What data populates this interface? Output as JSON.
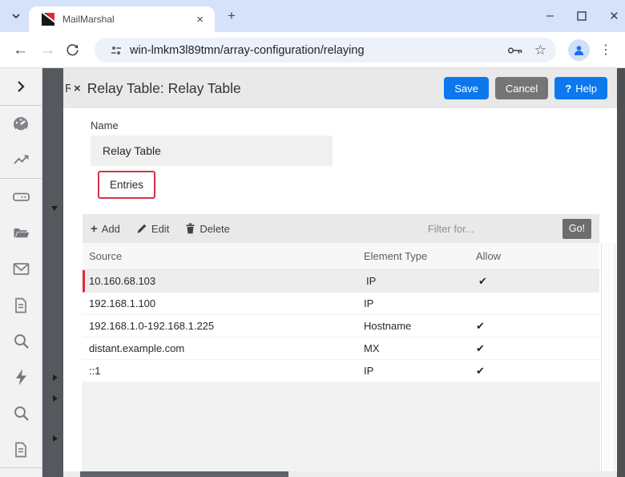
{
  "browser": {
    "tab_title": "MailMarshal",
    "url": "win-lmkm3l89tmn/array-configuration/relaying"
  },
  "glyphs": {
    "close": "×",
    "plus": "+",
    "minimize": "–",
    "back": "←",
    "forward": "→",
    "kebab": "⋮",
    "star": "☆"
  },
  "panel": {
    "clipped_text": "R",
    "close": "×",
    "title": "Relay Table: Relay Table",
    "save_label": "Save",
    "cancel_label": "Cancel",
    "help_q": "?",
    "help_label": "Help"
  },
  "form": {
    "name_label": "Name",
    "name_value": "Relay Table",
    "entries_tab": "Entries"
  },
  "toolbar": {
    "add_label": "Add",
    "edit_label": "Edit",
    "delete_label": "Delete",
    "filter_placeholder": "Filter for...",
    "go_label": "Go!"
  },
  "grid": {
    "columns": [
      "Source",
      "Element Type",
      "Allow"
    ],
    "rows": [
      {
        "source": "10.160.68.103",
        "element_type": "IP",
        "allow": "✔",
        "selected": true
      },
      {
        "source": "192.168.1.100",
        "element_type": "IP",
        "allow": "",
        "selected": false
      },
      {
        "source": "192.168.1.0-192.168.1.225",
        "element_type": "Hostname",
        "allow": "✔",
        "selected": false
      },
      {
        "source": "distant.example.com",
        "element_type": "MX",
        "allow": "✔",
        "selected": false
      },
      {
        "source": "::1",
        "element_type": "IP",
        "allow": "✔",
        "selected": false
      }
    ]
  },
  "icon_names": [
    "expand-chevron",
    "dashboard-gauge",
    "line-chart",
    "server-drive",
    "folder-open",
    "mail-envelope",
    "document",
    "search",
    "lightning",
    "search",
    "document"
  ],
  "colors": {
    "accent_blue": "#0d78ee",
    "cancel_gray": "#757575",
    "selected_red": "#e8253d",
    "entries_outline_red": "#d5304c",
    "tabstrip_blue": "#d5e2fa",
    "dark_strip": "#55595e"
  }
}
